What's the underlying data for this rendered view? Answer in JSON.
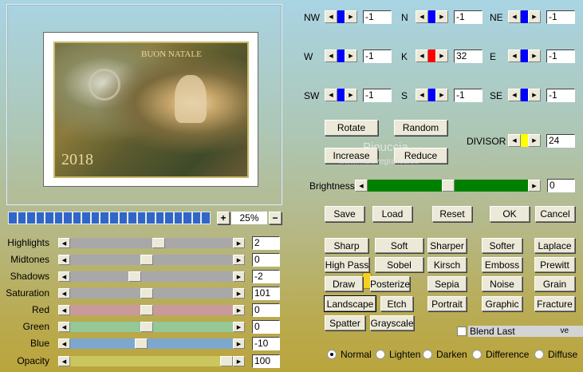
{
  "preview": {
    "card_title": "BUON NATALE",
    "year": "2018",
    "watermark_name": "Pinuccia",
    "watermark_url": "www.maidiregrafica.eu"
  },
  "matrix": [
    {
      "label": "NW",
      "value": "-1",
      "color": "#0000ff"
    },
    {
      "label": "N",
      "value": "-1",
      "color": "#0000ff"
    },
    {
      "label": "NE",
      "value": "-1",
      "color": "#0000ff"
    },
    {
      "label": "W",
      "value": "-1",
      "color": "#0000ff"
    },
    {
      "label": "K",
      "value": "32",
      "color": "#ff0000"
    },
    {
      "label": "E",
      "value": "-1",
      "color": "#0000ff"
    },
    {
      "label": "SW",
      "value": "-1",
      "color": "#0000ff"
    },
    {
      "label": "S",
      "value": "-1",
      "color": "#0000ff"
    },
    {
      "label": "SE",
      "value": "-1",
      "color": "#0000ff"
    }
  ],
  "matrix_buttons": {
    "rotate": "Rotate",
    "random": "Random",
    "increase": "Increase",
    "reduce": "Reduce"
  },
  "divisor": {
    "label": "DIVISOR",
    "value": "24",
    "color": "#ffff00"
  },
  "brightness": {
    "label": "Brightness",
    "value": "0",
    "position": 0.5,
    "color": "#008000"
  },
  "actions": {
    "save": "Save",
    "load": "Load",
    "reset": "Reset",
    "ok": "OK",
    "cancel": "Cancel"
  },
  "filters": [
    [
      "Sharp",
      "Soft",
      "Sharper",
      "Softer",
      "Laplace"
    ],
    [
      "High Pass",
      "Sobel",
      "Kirsch",
      "Emboss",
      "Prewitt"
    ],
    [
      "Draw",
      "Posterize",
      "Sepia",
      "Noise",
      "Grain"
    ],
    [
      "Landscape",
      "Etch",
      "Portrait",
      "Graphic",
      "Fracture"
    ],
    [
      "Spatter",
      "Grayscale"
    ]
  ],
  "focused_filter": "Landscape",
  "blend_last": {
    "label": "Blend Last",
    "suffix": "ve",
    "checked": false
  },
  "blend_modes": {
    "options": [
      "Normal",
      "Lighten",
      "Darken",
      "Difference",
      "Diffuse"
    ],
    "selected": "Normal"
  },
  "zoom": {
    "plus": "+",
    "minus": "−",
    "value": "25%",
    "progress": 1.0,
    "color": "#2f66c8"
  },
  "adjustments": [
    {
      "label": "Highlights",
      "value": "2",
      "position": 0.55,
      "track": "#a8a8a8"
    },
    {
      "label": "Midtones",
      "value": "0",
      "position": 0.47,
      "track": "#a8a8a8"
    },
    {
      "label": "Shadows",
      "value": "-2",
      "position": 0.39,
      "track": "#a8a8a8"
    },
    {
      "label": "Saturation",
      "value": "101",
      "position": 0.47,
      "track": "#a8a8a8"
    },
    {
      "label": "Red",
      "value": "0",
      "position": 0.47,
      "track": "#c99a9c"
    },
    {
      "label": "Green",
      "value": "0",
      "position": 0.47,
      "track": "#95c896"
    },
    {
      "label": "Blue",
      "value": "-10",
      "position": 0.43,
      "track": "#7ea7cf"
    },
    {
      "label": "Opacity",
      "value": "100",
      "position": 1.0,
      "track": "#cbc65e"
    }
  ]
}
